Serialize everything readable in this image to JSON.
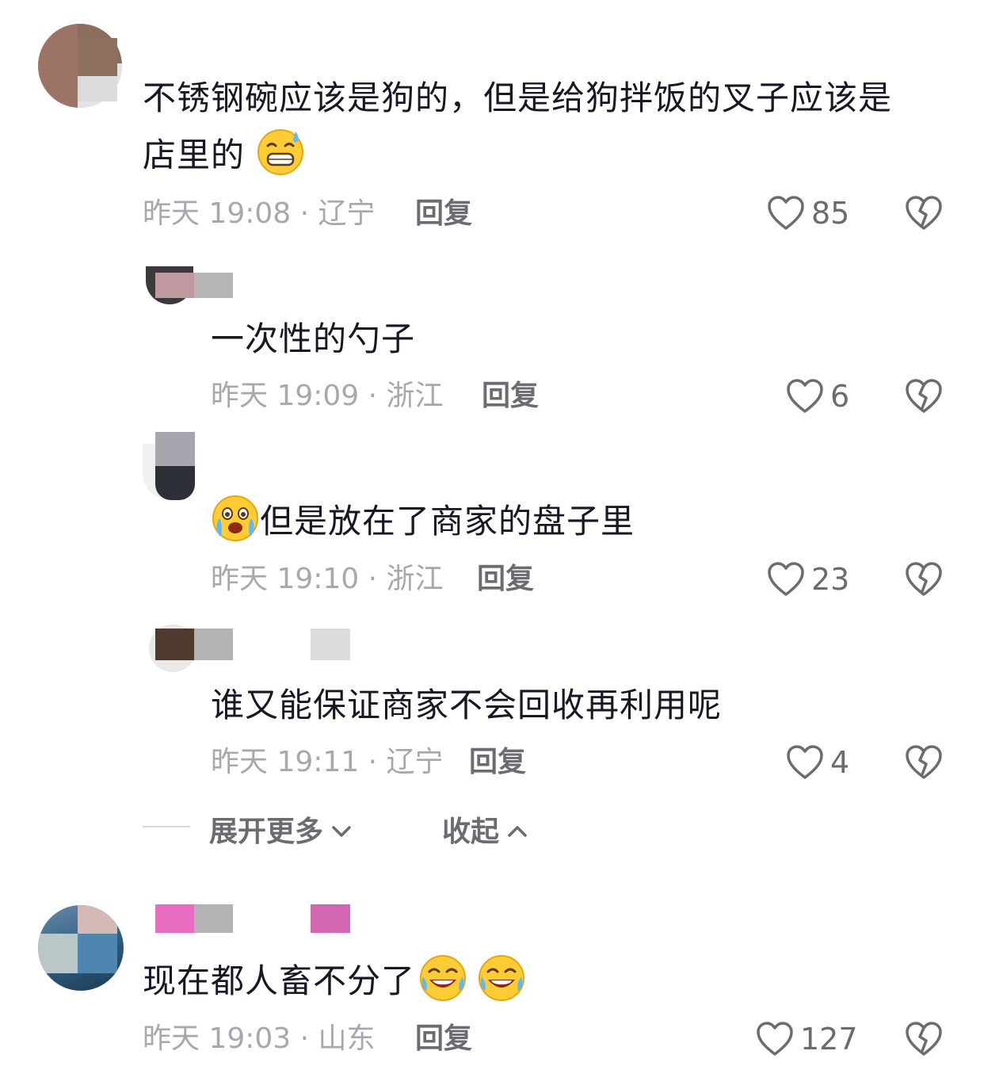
{
  "comments": [
    {
      "text_line1": "不锈钢碗应该是狗的，但是给狗拌饭的叉子应该是",
      "text_line2": "店里的",
      "emoji": "sweat-grin-emoji",
      "meta": "昨天 19:08 · 辽宁",
      "reply_label": "回复",
      "likes": "85"
    },
    {
      "text": "一次性的勺子",
      "meta": "昨天 19:09 · 浙江",
      "reply_label": "回复",
      "likes": "6"
    },
    {
      "text": "但是放在了商家的盘子里",
      "emoji": "crying-emoji",
      "meta": "昨天 19:10 · 浙江",
      "reply_label": "回复",
      "likes": "23"
    },
    {
      "text": "谁又能保证商家不会回收再利用呢",
      "meta": "昨天 19:11 · 辽宁",
      "reply_label": "回复",
      "likes": "4"
    },
    {
      "text": "现在都人畜不分了",
      "emoji": "laughing-tears-emoji",
      "meta": "昨天 19:03 · 山东",
      "reply_label": "回复",
      "likes": "127"
    }
  ],
  "thread_controls": {
    "expand_label": "展开更多",
    "collapse_label": "收起"
  },
  "colors": {
    "text": "#161823",
    "meta": "#a7a8ad",
    "action": "#6b6c72"
  }
}
